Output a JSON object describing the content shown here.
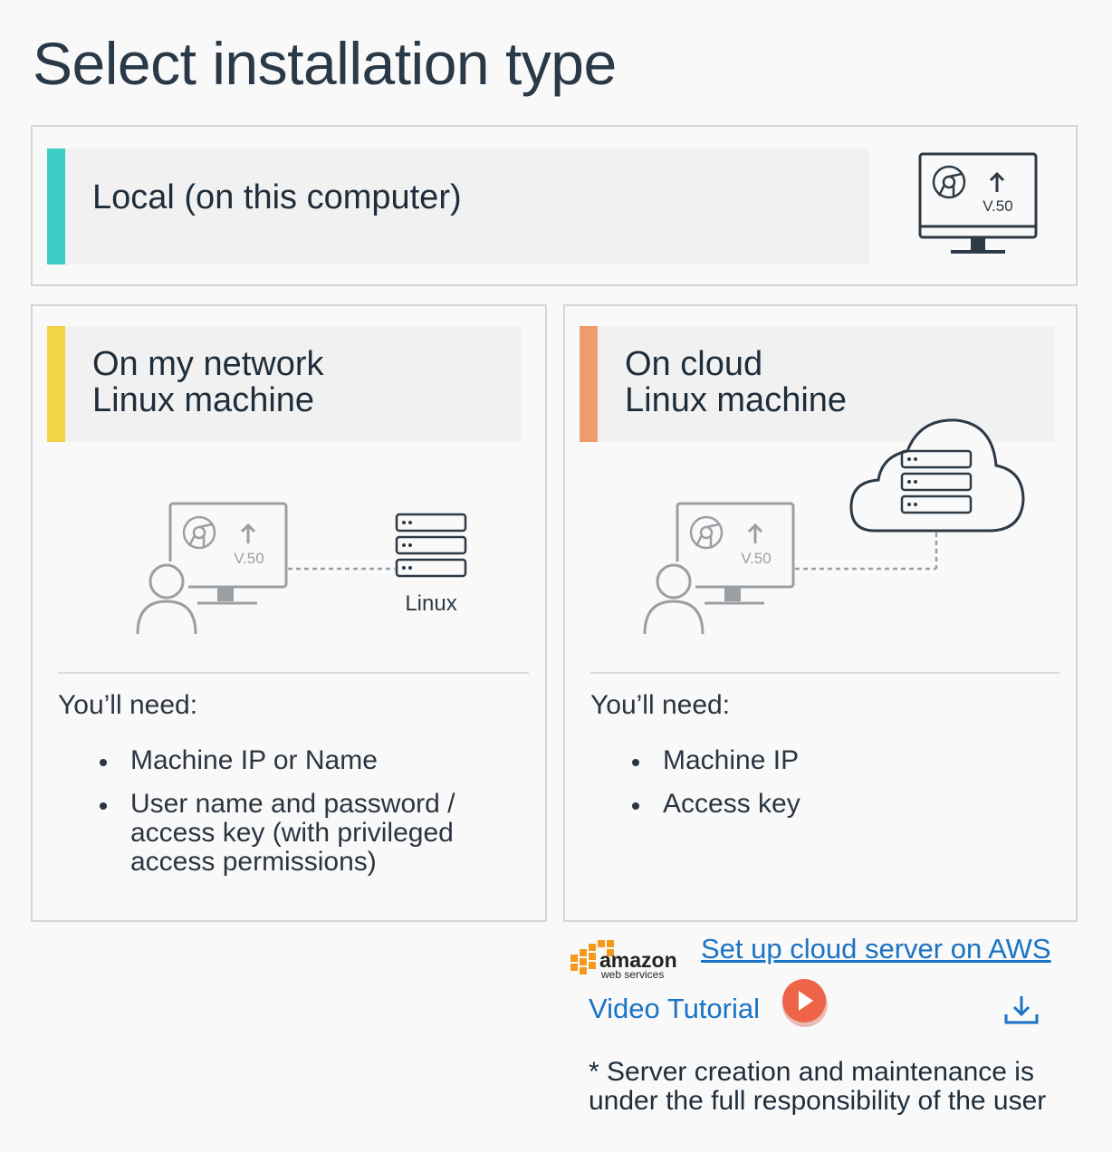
{
  "page": {
    "title": "Select installation type"
  },
  "options": {
    "local": {
      "label": "Local (on this computer)",
      "accent": "#3ecdc4",
      "version": "V.50"
    },
    "network": {
      "label_line1": "On my network",
      "label_line2": "Linux machine",
      "accent": "#f3d447",
      "version": "V.50",
      "server_label": "Linux",
      "needs_heading": "You’ll need:",
      "needs": [
        "Machine IP or Name",
        "User name and password / access key (with privileged access permissions)"
      ]
    },
    "cloud": {
      "label_line1": "On cloud",
      "label_line2": "Linux machine",
      "accent": "#ee9c6c",
      "version": "V.50",
      "needs_heading": "You’ll need:",
      "needs": [
        "Machine IP",
        "Access key"
      ]
    }
  },
  "aws": {
    "logo_word": "amazon",
    "logo_sub": "web services",
    "setup_link": "Set up cloud server on AWS",
    "video_link": "Video Tutorial",
    "play_icon": "play-icon",
    "download_icon": "download-icon",
    "note": "* Server creation and maintenance is under the full responsibility of the user"
  },
  "colors": {
    "link": "#1a73c4",
    "play": "#ee6449",
    "icon_stroke": "#2d3a45",
    "icon_light": "#9a9fa4"
  }
}
